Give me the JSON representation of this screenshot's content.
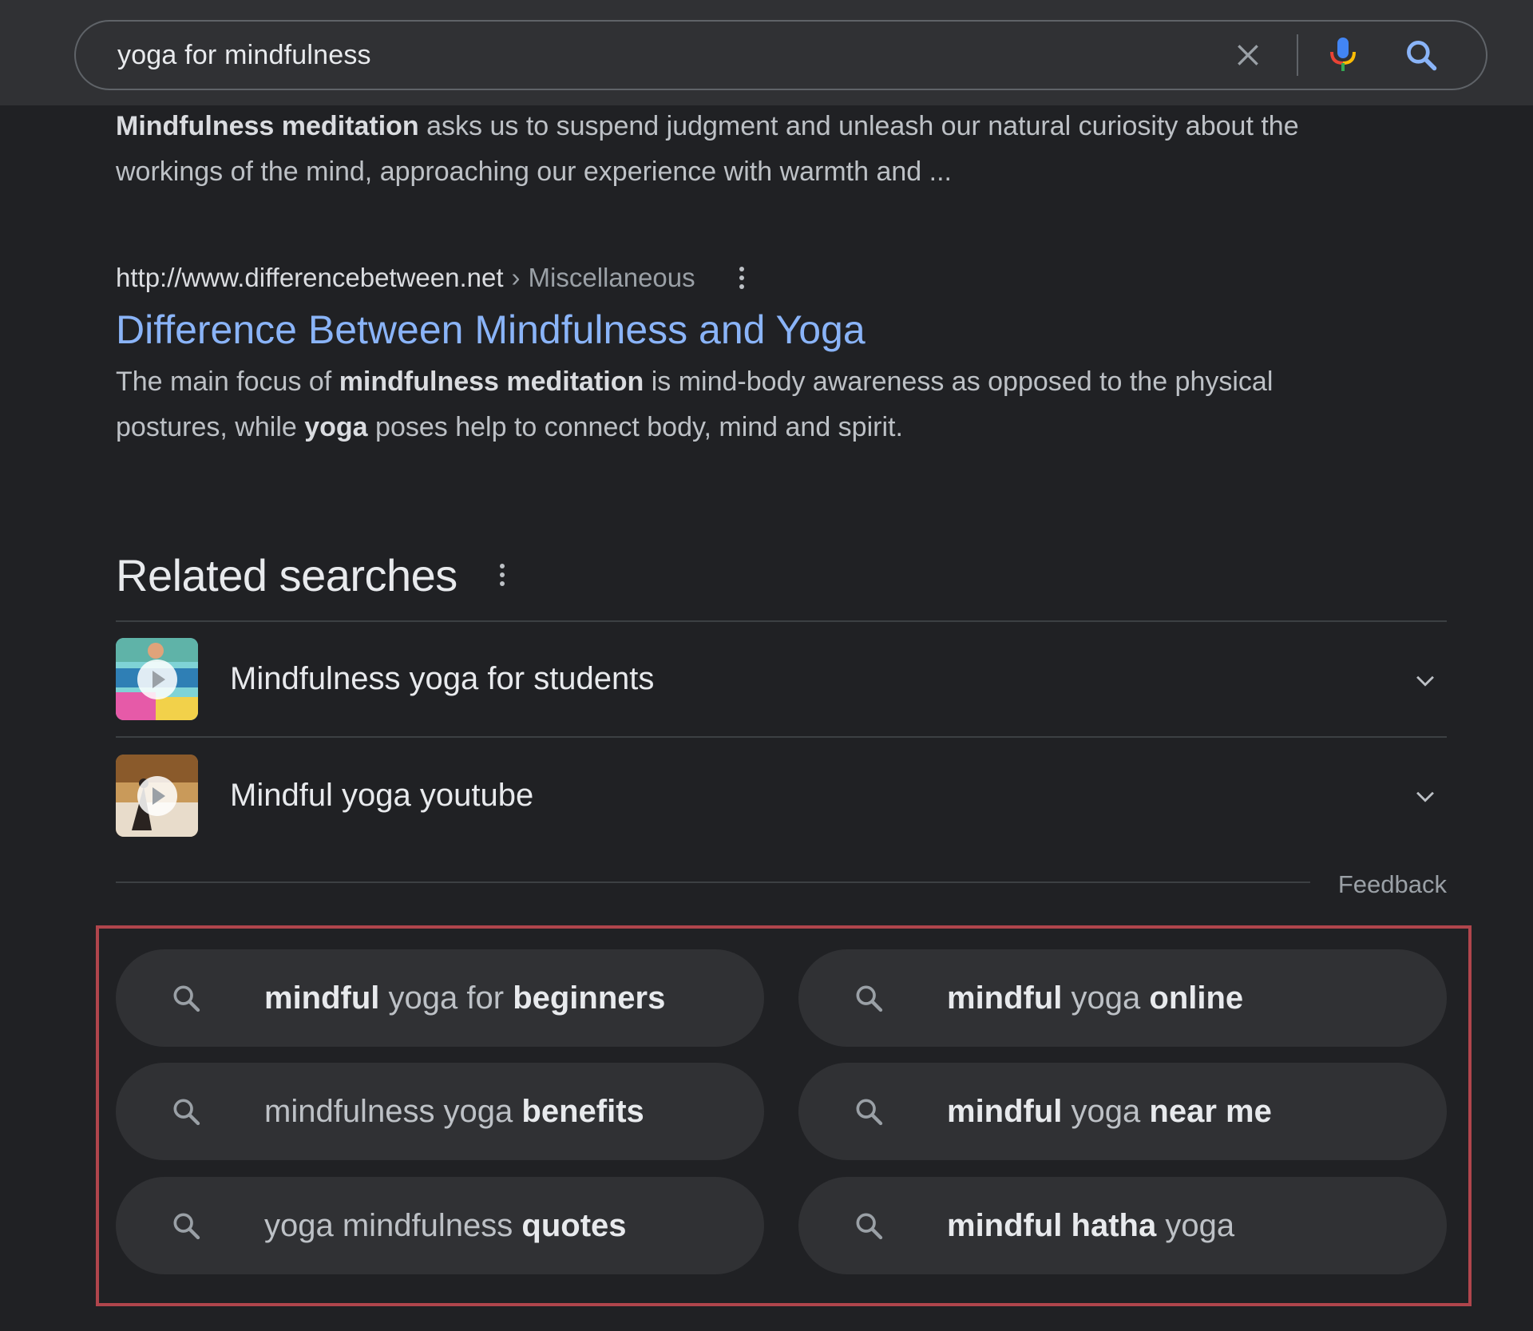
{
  "search": {
    "query": "yoga for mindfulness"
  },
  "snippet_top": {
    "bold": "Mindfulness meditation",
    "rest": " asks us to suspend judgment and unleash our natural curiosity about the workings of the mind, approaching our experience with warmth and ..."
  },
  "result": {
    "url": "http://www.differencebetween.net",
    "separator": "›",
    "breadcrumb": "Miscellaneous",
    "title": "Difference Between Mindfulness and Yoga",
    "desc_1": "The main focus of ",
    "desc_bold_1": "mindfulness meditation",
    "desc_2": " is mind-body awareness as opposed to the physical postures, while ",
    "desc_bold_2": "yoga",
    "desc_3": " poses help to connect body, mind and spirit."
  },
  "related": {
    "heading": "Related searches",
    "items": [
      {
        "label": "Mindfulness yoga for students"
      },
      {
        "label": "Mindful yoga youtube"
      }
    ],
    "feedback": "Feedback"
  },
  "chips": [
    {
      "parts": [
        {
          "t": "mindful",
          "b": true
        },
        {
          "t": " yoga for ",
          "b": false
        },
        {
          "t": "beginners",
          "b": true
        }
      ]
    },
    {
      "parts": [
        {
          "t": "mindful",
          "b": true
        },
        {
          "t": " yoga ",
          "b": false
        },
        {
          "t": "online",
          "b": true
        }
      ]
    },
    {
      "parts": [
        {
          "t": "mindfulness yoga ",
          "b": false
        },
        {
          "t": "benefits",
          "b": true
        }
      ]
    },
    {
      "parts": [
        {
          "t": "mindful",
          "b": true
        },
        {
          "t": " yoga ",
          "b": false
        },
        {
          "t": "near me",
          "b": true
        }
      ]
    },
    {
      "parts": [
        {
          "t": "yoga mindfulness ",
          "b": false
        },
        {
          "t": "quotes",
          "b": true
        }
      ]
    },
    {
      "parts": [
        {
          "t": "mindful hatha",
          "b": true
        },
        {
          "t": " yoga",
          "b": false
        }
      ]
    }
  ],
  "colors": {
    "background": "#202124",
    "link": "#8ab4f8",
    "highlight_border": "#b0454c"
  },
  "icons": [
    "close-icon",
    "microphone-icon",
    "search-icon",
    "more-vert-icon",
    "chevron-down-icon",
    "play-icon"
  ]
}
